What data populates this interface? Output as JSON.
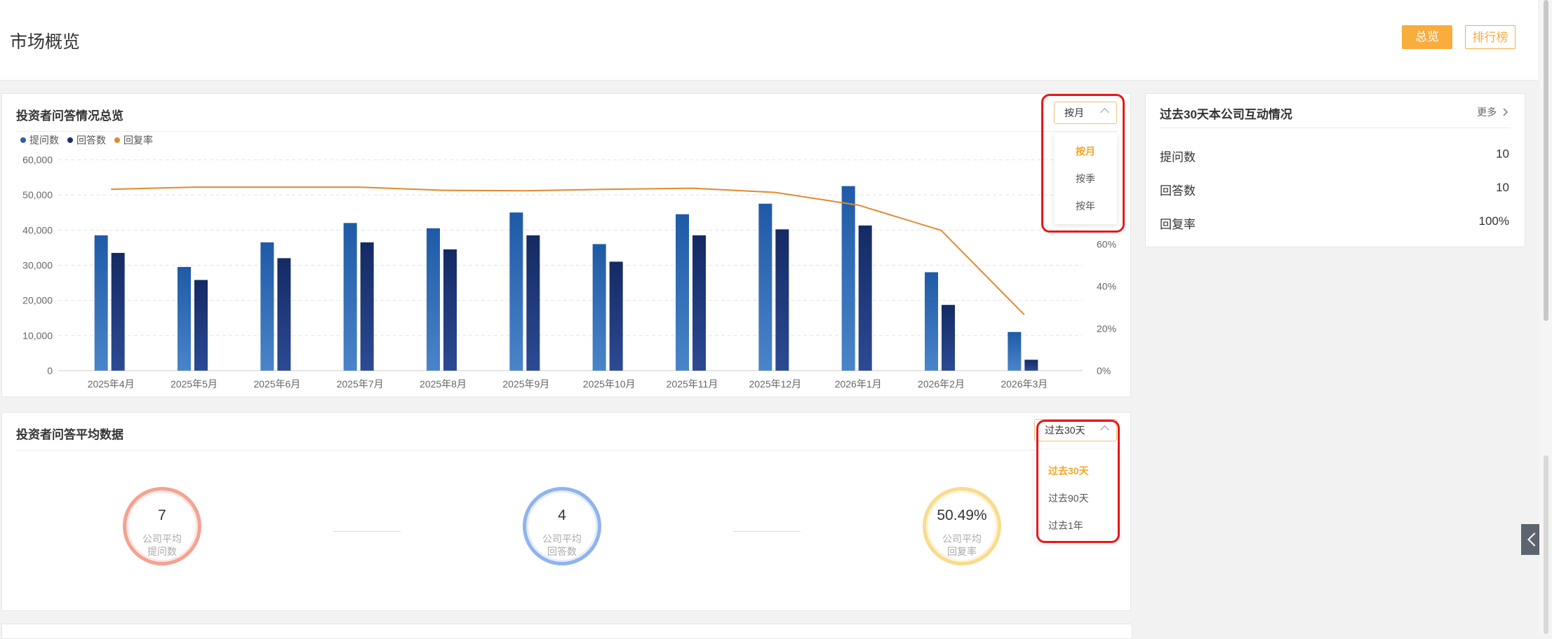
{
  "header": {
    "title": "市场概览",
    "overview_label": "总览",
    "ranking_label": "排行榜"
  },
  "qa_card": {
    "title": "投资者问答情况总览",
    "period_select": {
      "value": "按月",
      "options": [
        "按月",
        "按季",
        "按年"
      ],
      "active_index": 0
    }
  },
  "chart_data": {
    "type": "bar",
    "categories": [
      "2025年4月",
      "2025年5月",
      "2025年6月",
      "2025年7月",
      "2025年8月",
      "2025年9月",
      "2025年10月",
      "2025年11月",
      "2025年12月",
      "2026年1月",
      "2026年2月",
      "2026年3月"
    ],
    "series": [
      {
        "name": "提问数",
        "type": "bar",
        "axis": "left",
        "color": "#2e5fa8",
        "values": [
          38500,
          29500,
          36500,
          42000,
          40500,
          45000,
          36000,
          44500,
          47500,
          52500,
          28000,
          11000
        ]
      },
      {
        "name": "回答数",
        "type": "bar",
        "axis": "left",
        "color": "#1a2f6b",
        "values": [
          33500,
          25800,
          32000,
          36500,
          34500,
          38500,
          31000,
          38500,
          40200,
          41300,
          18700,
          3100
        ]
      },
      {
        "name": "回复率",
        "type": "line",
        "axis": "right",
        "color": "#e08a2e",
        "values": [
          0.86,
          0.87,
          0.87,
          0.87,
          0.855,
          0.853,
          0.86,
          0.865,
          0.845,
          0.785,
          0.665,
          0.265
        ]
      }
    ],
    "y_left": {
      "min": 0,
      "max": 60000,
      "ticks": [
        "0",
        "10,000",
        "20,000",
        "30,000",
        "40,000",
        "50,000",
        "60,000"
      ]
    },
    "y_right": {
      "min": 0,
      "max": 1,
      "ticks": [
        "0%",
        "20%",
        "40%",
        "60%"
      ]
    },
    "grid": true,
    "legend_position": "top-left"
  },
  "side_card": {
    "title": "过去30天本公司互动情况",
    "more_label": "更多",
    "stats": [
      {
        "label": "提问数",
        "value": "10"
      },
      {
        "label": "回答数",
        "value": "10"
      },
      {
        "label": "回复率",
        "value": "100%"
      }
    ]
  },
  "avg_card": {
    "title": "投资者问答平均数据",
    "range_select": {
      "value": "过去30天",
      "options": [
        "过去30天",
        "过去90天",
        "过去1年"
      ],
      "active_index": 0
    },
    "metrics": [
      {
        "value": "7",
        "label": "公司平均提问数",
        "color": "#f3a293"
      },
      {
        "value": "4",
        "label": "公司平均回答数",
        "color": "#8fb3ee"
      },
      {
        "value": "50.49%",
        "label": "公司平均回复率",
        "color": "#f8dc8e"
      }
    ]
  },
  "icons": {
    "chevron_up": "chevron-up-icon",
    "chevron_right": "chevron-right-icon",
    "collapse": "chevron-left-icon"
  }
}
